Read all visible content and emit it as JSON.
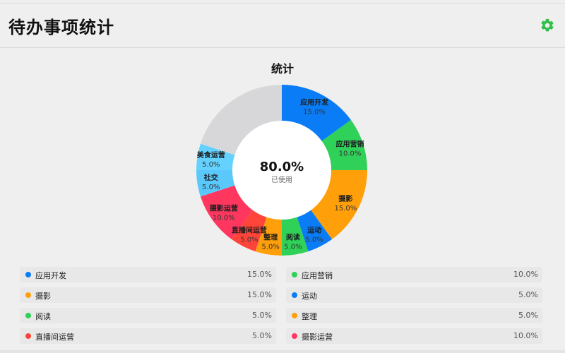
{
  "header": {
    "title": "待办事项统计",
    "settings_icon": "gear-icon",
    "accent_color": "#30c048"
  },
  "chart_title": "统计",
  "center": {
    "value": "80.0%",
    "label": "已使用"
  },
  "chart_data": {
    "type": "pie",
    "style": "donut",
    "title": "统计",
    "unit": "%",
    "slices": [
      {
        "label": "应用开发",
        "value": 15.0,
        "value_label": "15.0%",
        "color": "#0a7cf5"
      },
      {
        "label": "应用营销",
        "value": 10.0,
        "value_label": "10.0%",
        "color": "#30d158"
      },
      {
        "label": "摄影",
        "value": 15.0,
        "value_label": "15.0%",
        "color": "#ff9f0a"
      },
      {
        "label": "运动",
        "value": 5.0,
        "value_label": "5.0%",
        "color": "#0a7cf5"
      },
      {
        "label": "阅读",
        "value": 5.0,
        "value_label": "5.0%",
        "color": "#30d158"
      },
      {
        "label": "整理",
        "value": 5.0,
        "value_label": "5.0%",
        "color": "#ff9f0a"
      },
      {
        "label": "直播间运营",
        "value": 5.0,
        "value_label": "5.0%",
        "color": "#ff453a"
      },
      {
        "label": "摄影运营",
        "value": 10.0,
        "value_label": "10.0%",
        "color": "#ff375f"
      },
      {
        "label": "社交",
        "value": 5.0,
        "value_label": "5.0%",
        "color": "#5ac8fa"
      },
      {
        "label": "美食运营",
        "value": 5.0,
        "value_label": "5.0%",
        "color": "#64d2ff"
      },
      {
        "label": "",
        "value": 20.0,
        "value_label": "",
        "color": "#d7d7d9"
      }
    ],
    "legend_position": "bottom"
  },
  "legend": [
    {
      "label": "应用开发",
      "value": "15.0%",
      "color": "#0a7cf5"
    },
    {
      "label": "应用营销",
      "value": "10.0%",
      "color": "#30d158"
    },
    {
      "label": "摄影",
      "value": "15.0%",
      "color": "#ff9f0a"
    },
    {
      "label": "运动",
      "value": "5.0%",
      "color": "#0a7cf5"
    },
    {
      "label": "阅读",
      "value": "5.0%",
      "color": "#30d158"
    },
    {
      "label": "整理",
      "value": "5.0%",
      "color": "#ff9f0a"
    },
    {
      "label": "直播间运营",
      "value": "5.0%",
      "color": "#ff453a"
    },
    {
      "label": "摄影运营",
      "value": "10.0%",
      "color": "#ff375f"
    }
  ]
}
